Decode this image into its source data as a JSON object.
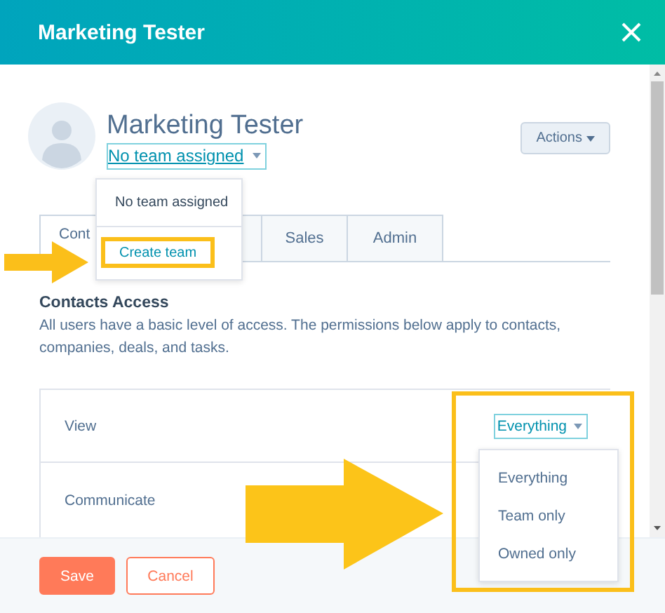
{
  "window": {
    "title": "Marketing Tester"
  },
  "profile": {
    "name": "Marketing Tester",
    "team": "No team assigned",
    "actions_button": "Actions"
  },
  "team_menu": {
    "items": [
      {
        "label": "No team assigned",
        "highlighted": false
      },
      {
        "label": "Create team",
        "highlighted": true
      }
    ]
  },
  "tabs": [
    {
      "label": "Cont",
      "selected": true
    },
    {
      "selected": false
    },
    {
      "label": "Sales",
      "selected": false
    },
    {
      "label": "Admin",
      "selected": false
    }
  ],
  "section": {
    "title": "Contacts Access",
    "description": "All users have a basic level of access. The permissions below apply to contacts, companies, deals, and tasks."
  },
  "permissions": [
    {
      "label": "View",
      "value": "Everything"
    },
    {
      "label": "Communicate"
    }
  ],
  "access_menu": {
    "highlighted": true,
    "items": [
      "Everything",
      "Team only",
      "Owned only"
    ]
  },
  "buttons": [
    {
      "label": "Save",
      "kind": "primary"
    },
    {
      "label": "Cancel",
      "kind": "secondary"
    }
  ]
}
